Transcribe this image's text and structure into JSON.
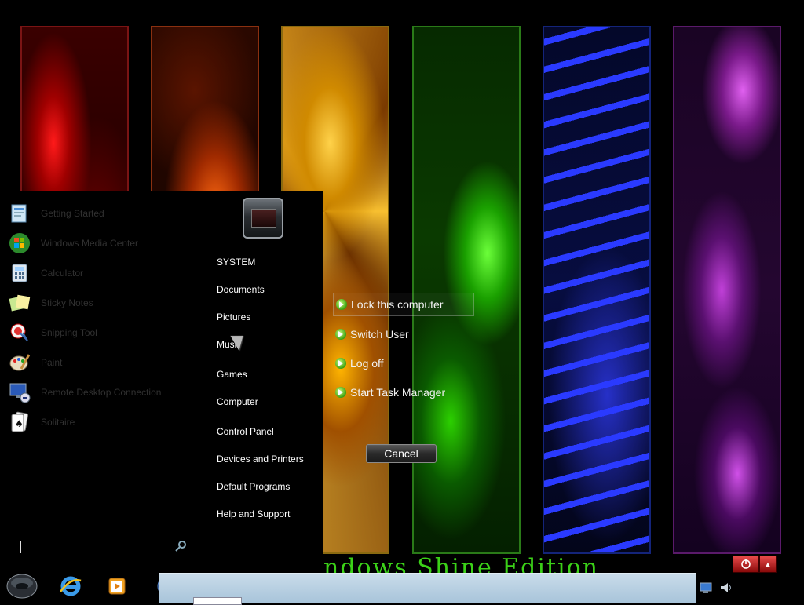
{
  "wallpaper": {
    "panels": [
      "red",
      "orange",
      "yellow",
      "green",
      "blue",
      "purple"
    ],
    "brand_text": "ndows Shine Edition"
  },
  "start_menu": {
    "programs": [
      {
        "label": "Getting Started",
        "icon": "getting-started-icon"
      },
      {
        "label": "Windows Media Center",
        "icon": "windows-logo-icon"
      },
      {
        "label": "Calculator",
        "icon": "calculator-icon"
      },
      {
        "label": "Sticky Notes",
        "icon": "sticky-notes-icon"
      },
      {
        "label": "Snipping Tool",
        "icon": "snipping-tool-icon"
      },
      {
        "label": "Paint",
        "icon": "paint-icon"
      },
      {
        "label": "Remote Desktop Connection",
        "icon": "remote-desktop-icon"
      },
      {
        "label": "Solitaire",
        "icon": "solitaire-icon"
      }
    ],
    "right_links": [
      "SYSTEM",
      "Documents",
      "Pictures",
      "Music",
      "Games",
      "Computer",
      "Control Panel",
      "Devices and Printers",
      "Default Programs",
      "Help and Support"
    ]
  },
  "power_menu": {
    "items": [
      "Lock this computer",
      "Switch User",
      "Log off",
      "Start Task Manager"
    ],
    "cancel_label": "Cancel"
  },
  "taskbar": {
    "buttons": [
      "start-orb-icon",
      "internet-explorer-icon",
      "media-player-icon",
      "network-globe-icon",
      "tablet-icon",
      "panels-icon"
    ],
    "tray": [
      "network-icon",
      "volume-icon"
    ]
  },
  "colors": {
    "brand_green": "#3bd018",
    "shutdown_red": "#c01818",
    "taskbar_preview": "#bcd3e4"
  }
}
